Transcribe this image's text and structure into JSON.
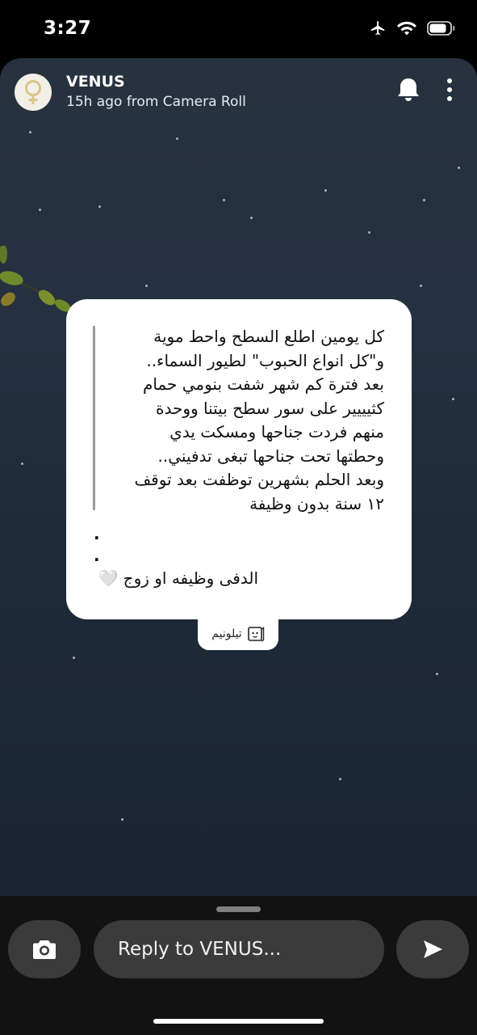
{
  "status_bar": {
    "time": "3:27",
    "icons": [
      "airplane-icon",
      "wifi-icon",
      "battery-icon"
    ]
  },
  "story": {
    "user_name": "VENUS",
    "meta": "15h ago from Camera Roll",
    "header_icons": [
      "venus-symbol-icon",
      "bell-icon",
      "more-vertical-icon"
    ],
    "card": {
      "lines": [
        "كل يومين اطلع السطح واحط موية",
        "و\"كل انواع الحبوب\" لطيور السماء..",
        "بعد فترة كم شهر شفت بنومي حمام",
        "كثيييير على سور سطح بيتنا ووحدة",
        "منهم فردت جناحها ومسكت يدي",
        "وحطتها تحت جناحها تبغى تدفيني..",
        "وبعد الحلم بشهرين توظفت بعد توقف",
        "١٢ سنة بدون وظيفة"
      ],
      "dots": [
        ".",
        "."
      ],
      "footer": "الدفى وظيفه او زوج",
      "footer_emoji": "🤍"
    },
    "source_tag": "تيلونيم"
  },
  "bottom_bar": {
    "reply_placeholder": "Reply to VENUS...",
    "icons": [
      "camera-icon",
      "send-icon"
    ]
  },
  "colors": {
    "background": "#000000",
    "story_top": "#28323f",
    "story_bottom": "#1b2532",
    "card": "#ffffff",
    "button": "#3b3b3b"
  }
}
